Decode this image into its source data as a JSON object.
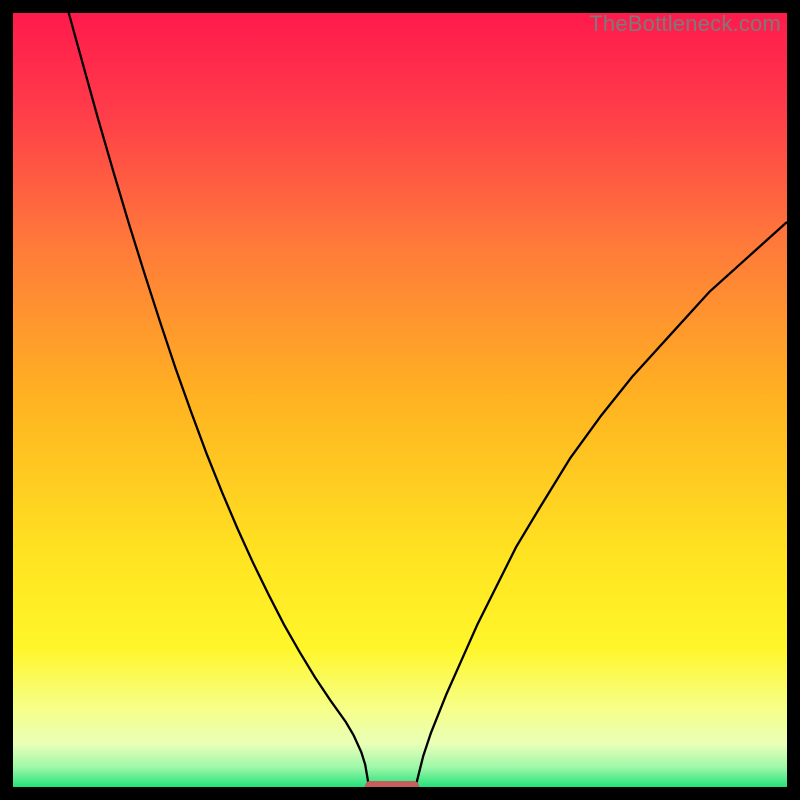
{
  "watermark": "TheBottleneck.com",
  "chart_data": {
    "type": "line",
    "title": "",
    "xlabel": "",
    "ylabel": "",
    "xlim": [
      0,
      1
    ],
    "ylim": [
      0,
      1
    ],
    "grid": false,
    "legend": false,
    "background_gradient": {
      "stops": [
        {
          "offset": 0.0,
          "color": "#ff1a4c"
        },
        {
          "offset": 0.12,
          "color": "#ff3a4a"
        },
        {
          "offset": 0.3,
          "color": "#ff7a3a"
        },
        {
          "offset": 0.5,
          "color": "#ffb321"
        },
        {
          "offset": 0.7,
          "color": "#ffe321"
        },
        {
          "offset": 0.82,
          "color": "#fff62a"
        },
        {
          "offset": 0.9,
          "color": "#f6ff8a"
        },
        {
          "offset": 0.945,
          "color": "#e8ffb8"
        },
        {
          "offset": 0.975,
          "color": "#9cf7a8"
        },
        {
          "offset": 1.0,
          "color": "#23e27a"
        }
      ]
    },
    "series": [
      {
        "name": "curve",
        "color": "#000000",
        "width": 2.3,
        "x": [
          0.072,
          0.09,
          0.11,
          0.13,
          0.15,
          0.17,
          0.19,
          0.21,
          0.23,
          0.25,
          0.27,
          0.29,
          0.31,
          0.33,
          0.35,
          0.37,
          0.39,
          0.41,
          0.43,
          0.44,
          0.45,
          0.455,
          0.46,
          0.52,
          0.53,
          0.54,
          0.56,
          0.58,
          0.6,
          0.62,
          0.65,
          0.68,
          0.72,
          0.76,
          0.8,
          0.85,
          0.9,
          0.95,
          1.0
        ],
        "y": [
          1.0,
          0.935,
          0.863,
          0.794,
          0.727,
          0.663,
          0.601,
          0.541,
          0.485,
          0.431,
          0.381,
          0.334,
          0.29,
          0.249,
          0.21,
          0.175,
          0.142,
          0.112,
          0.084,
          0.067,
          0.045,
          0.029,
          0.0,
          0.0,
          0.04,
          0.07,
          0.12,
          0.165,
          0.21,
          0.25,
          0.31,
          0.36,
          0.425,
          0.48,
          0.53,
          0.585,
          0.64,
          0.685,
          0.73
        ]
      }
    ],
    "marker": {
      "x_start": 0.455,
      "x_end": 0.525,
      "y": 0.0,
      "color": "#c65e5c"
    }
  }
}
